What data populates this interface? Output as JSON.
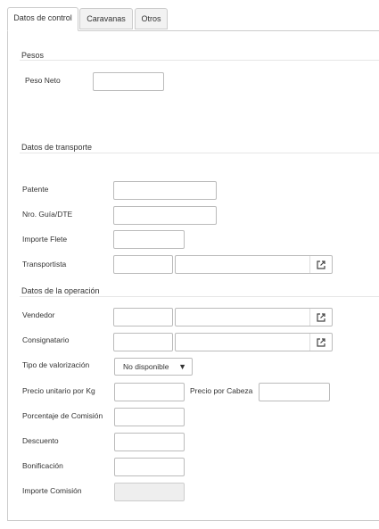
{
  "tabs": [
    {
      "label": "Datos de control"
    },
    {
      "label": "Caravanas"
    },
    {
      "label": "Otros"
    }
  ],
  "pesos": {
    "title": "Pesos",
    "peso_neto_label": "Peso Neto",
    "peso_neto_value": ""
  },
  "transporte": {
    "title": "Datos de transporte",
    "patente_label": "Patente",
    "guia_label": "Nro. Guía/DTE",
    "flete_label": "Importe Flete",
    "transportista_label": "Transportista"
  },
  "operacion": {
    "title": "Datos de la operación",
    "vendedor_label": "Vendedor",
    "consignatario_label": "Consignatario",
    "tipo_valorizacion_label": "Tipo de valorización",
    "tipo_valorizacion_value": "No disponible",
    "precio_kg_label": "Precio unitario por Kg",
    "precio_cabeza_label": "Precio por Cabeza",
    "comision_label": "Porcentaje de Comisión",
    "descuento_label": "Descuento",
    "bonificacion_label": "Bonificación",
    "importe_comision_label": "Importe Comisión"
  },
  "icons": {
    "external_link": "external-link-icon",
    "caret": "caret-down-icon"
  }
}
